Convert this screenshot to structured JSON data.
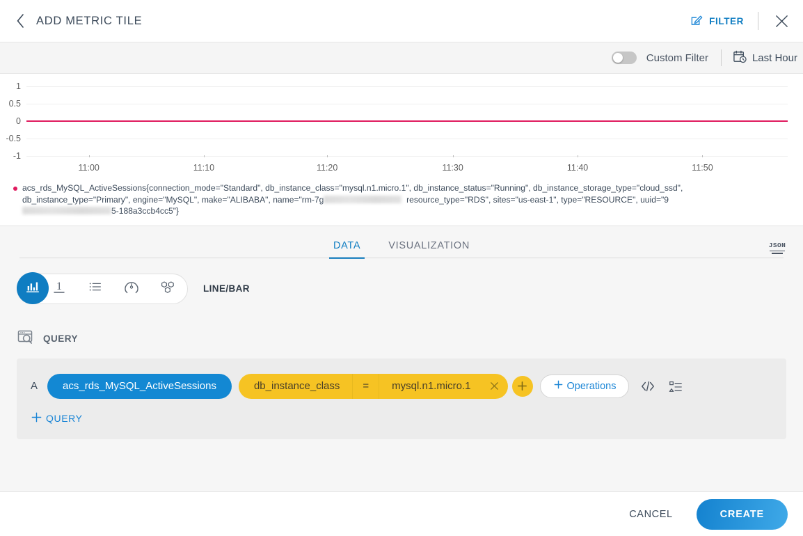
{
  "header": {
    "back_icon": "chevron-left-icon",
    "title": "ADD METRIC TILE",
    "filter_label": "FILTER",
    "filter_icon": "edit-square-icon",
    "close_icon": "close-icon"
  },
  "filterbar": {
    "custom_filter_label": "Custom Filter",
    "custom_filter_on": false,
    "time_range_label": "Last Hour",
    "time_range_icon": "calendar-clock-icon"
  },
  "chart_data": {
    "type": "line",
    "title": "",
    "xlabel": "",
    "ylabel": "",
    "x": [
      "11:00",
      "11:10",
      "11:20",
      "11:30",
      "11:40",
      "11:50"
    ],
    "yticks": [
      "1",
      "0.5",
      "0",
      "-0.5",
      "-1"
    ],
    "ylim": [
      -1,
      1
    ],
    "grid": true,
    "series": [
      {
        "name": "acs_rds_MySQL_ActiveSessions",
        "color": "#e01a5e",
        "values": [
          0,
          0,
          0,
          0,
          0,
          0
        ]
      }
    ],
    "legend_position": "bottom"
  },
  "legend": {
    "color": "#e01a5e",
    "part1": "acs_rds_MySQL_ActiveSessions{connection_mode=\"Standard\", db_instance_class=\"mysql.n1.micro.1\", db_instance_status=\"Running\", db_instance_storage_type=\"cloud_ssd\", db_instance_type=\"Primary\", engine=\"MySQL\", make=\"ALIBABA\", name=\"rm-7g",
    "redacted1": "",
    "part2": "resource_type=\"RDS\", sites=\"us-east-1\", type=\"RESOURCE\", uuid=\"9",
    "redacted2": "",
    "part3": "5-188a3ccb4cc5\"}"
  },
  "tabs": {
    "items": [
      {
        "label": "DATA",
        "active": true
      },
      {
        "label": "VISUALIZATION",
        "active": false
      }
    ],
    "json_icon_label": "JSON",
    "json_icon": "json-lines-icon"
  },
  "viz_selector": {
    "options": [
      {
        "icon": "bar-chart-icon",
        "selected": true
      },
      {
        "icon": "single-value-one-icon",
        "selected": false
      },
      {
        "icon": "list-icon",
        "selected": false
      },
      {
        "icon": "gauge-icon",
        "selected": false
      },
      {
        "icon": "honeycomb-icon",
        "selected": false
      }
    ],
    "label": "LINE/BAR"
  },
  "query_section": {
    "icon": "query-search-icon",
    "title": "QUERY",
    "rows": [
      {
        "letter": "A",
        "metric": "acs_rds_MySQL_ActiveSessions",
        "filter_key": "db_instance_class",
        "filter_op": "=",
        "filter_value": "mysql.n1.micro.1",
        "remove_icon": "close-icon",
        "add_filter_icon": "plus-icon",
        "operations_label": "Operations",
        "operations_icon": "plus-icon",
        "code_icon": "code-brackets-icon",
        "tree_icon": "hierarchy-icon"
      }
    ],
    "add_query_label": "QUERY",
    "add_query_icon": "plus-icon"
  },
  "footer": {
    "cancel_label": "CANCEL",
    "create_label": "CREATE"
  },
  "colors": {
    "accent_blue": "#0f7dc2",
    "series_crimson": "#e01a5e",
    "chip_yellow": "#f6c323",
    "chip_blue": "#1388d3"
  }
}
